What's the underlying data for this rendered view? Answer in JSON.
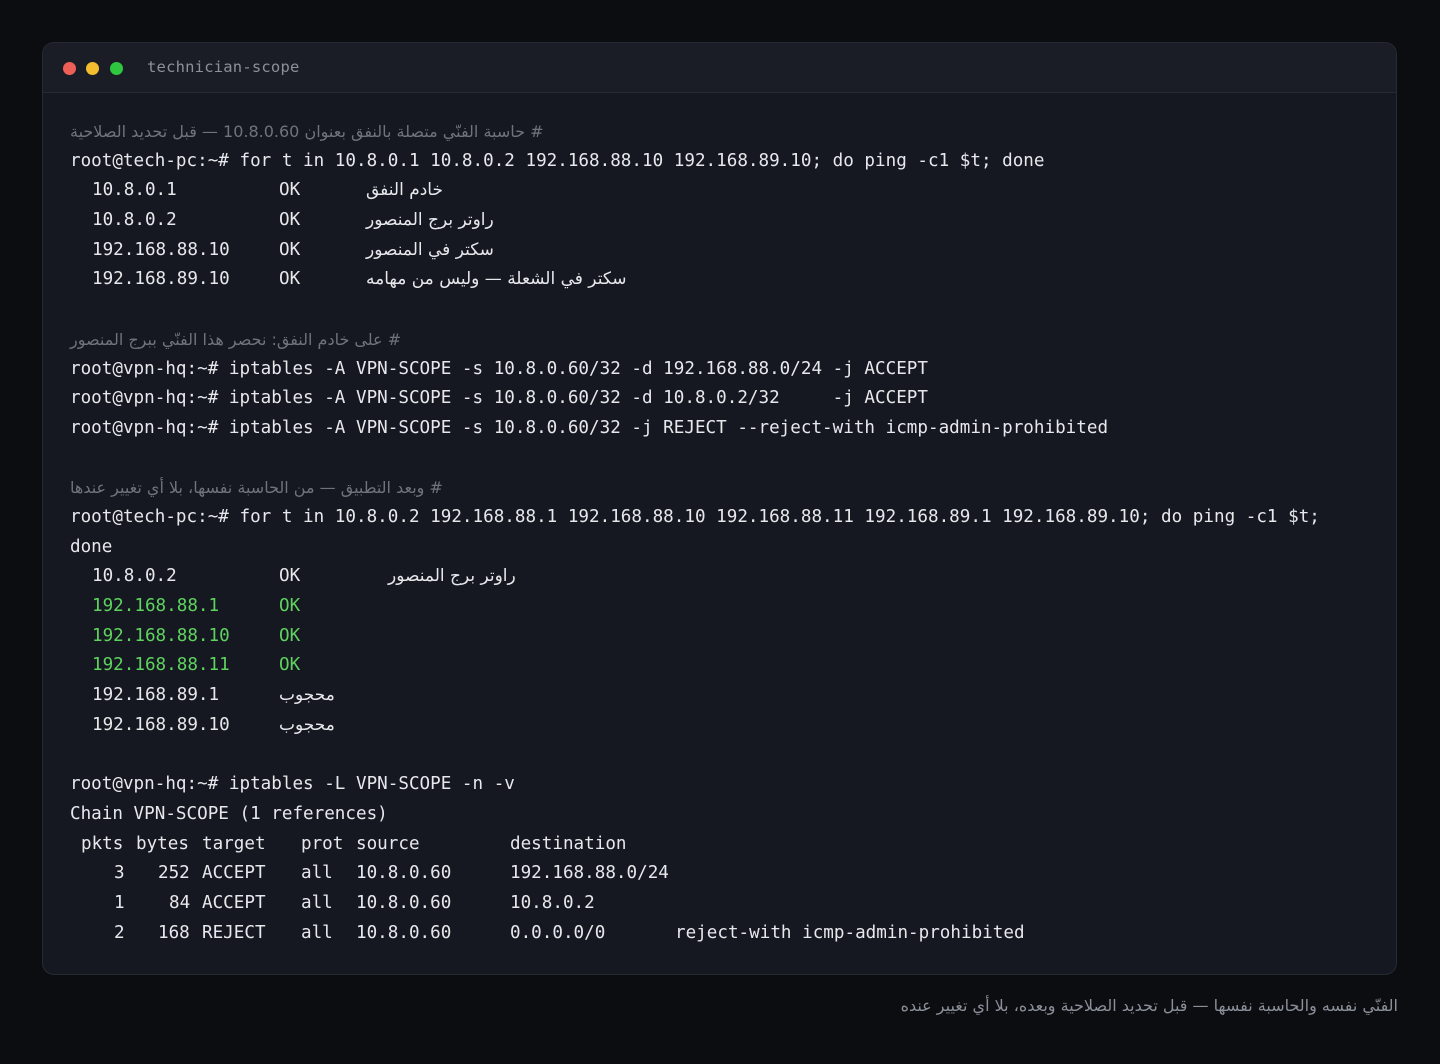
{
  "window": {
    "title": "technician-scope"
  },
  "block1": {
    "comment": "# حاسبة الفنّي متصلة بالنفق بعنوان 10.8.0.60 — قبل تحديد الصلاحية",
    "cmd": "root@tech-pc:~# for t in 10.8.0.1 10.8.0.2 192.168.88.10 192.168.89.10; do ping -c1 $t; done",
    "rows": [
      {
        "ip": "10.8.0.1",
        "status": "OK",
        "note": "خادم النفق"
      },
      {
        "ip": "10.8.0.2",
        "status": "OK",
        "note": "راوتر برج المنصور"
      },
      {
        "ip": "192.168.88.10",
        "status": "OK",
        "note": "سكتر في المنصور"
      },
      {
        "ip": "192.168.89.10",
        "status": "OK",
        "note": "سكتر في الشعلة — وليس من مهامه"
      }
    ]
  },
  "block2": {
    "comment": "# على خادم النفق: نحصر هذا الفنّي ببرج المنصور",
    "cmds": [
      "root@vpn-hq:~# iptables -A VPN-SCOPE -s 10.8.0.60/32 -d 192.168.88.0/24 -j ACCEPT",
      "root@vpn-hq:~# iptables -A VPN-SCOPE -s 10.8.0.60/32 -d 10.8.0.2/32     -j ACCEPT",
      "root@vpn-hq:~# iptables -A VPN-SCOPE -s 10.8.0.60/32 -j REJECT --reject-with icmp-admin-prohibited"
    ]
  },
  "block3": {
    "comment": "# وبعد التطبيق — من الحاسبة نفسها، بلا أي تغيير عندها",
    "cmd": "root@tech-pc:~# for t in 10.8.0.2 192.168.88.1 192.168.88.10 192.168.88.11 192.168.89.1 192.168.89.10; do ping -c1 $t;",
    "cmd_wrap": "done",
    "rows": [
      {
        "ip": "10.8.0.2",
        "status": "OK",
        "note": "راوتر برج المنصور"
      },
      {
        "ip": "192.168.88.1",
        "status": "OK",
        "note": ""
      },
      {
        "ip": "192.168.88.10",
        "status": "OK",
        "note": ""
      },
      {
        "ip": "192.168.88.11",
        "status": "OK",
        "note": ""
      },
      {
        "ip": "192.168.89.1",
        "status": "محجوب",
        "note": ""
      },
      {
        "ip": "192.168.89.10",
        "status": "محجوب",
        "note": ""
      }
    ],
    "allowed_color": "#5fd35f"
  },
  "block4": {
    "cmd": "root@vpn-hq:~# iptables -L VPN-SCOPE -n -v",
    "chain": "Chain VPN-SCOPE (1 references)",
    "header": {
      "pkts": "pkts",
      "bytes": "bytes",
      "target": "target",
      "prot": "prot",
      "source": "source",
      "destination": "destination"
    },
    "rows": [
      {
        "pkts": "3",
        "bytes": "252",
        "target": "ACCEPT",
        "prot": "all",
        "source": "10.8.0.60",
        "destination": "192.168.88.0/24",
        "extra": ""
      },
      {
        "pkts": "1",
        "bytes": "84",
        "target": "ACCEPT",
        "prot": "all",
        "source": "10.8.0.60",
        "destination": "10.8.0.2",
        "extra": ""
      },
      {
        "pkts": "2",
        "bytes": "168",
        "target": "REJECT",
        "prot": "all",
        "source": "10.8.0.60",
        "destination": "0.0.0.0/0",
        "extra": "reject-with icmp-admin-prohibited"
      }
    ]
  },
  "caption": "الفنّي نفسه والحاسبة نفسها — قبل تحديد الصلاحية وبعده، بلا أي تغيير عنده"
}
